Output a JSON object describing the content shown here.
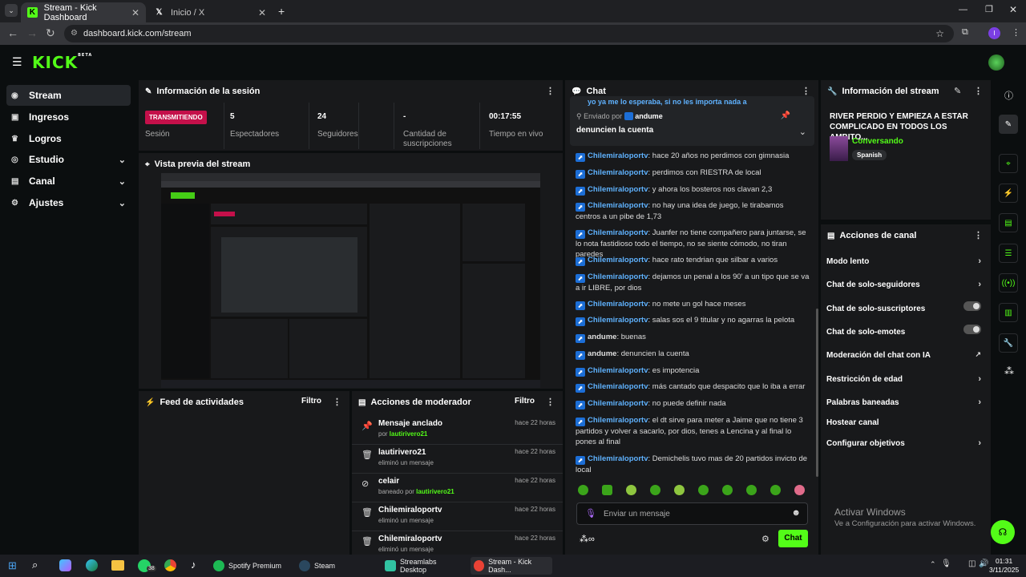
{
  "browser": {
    "tabs": [
      {
        "title": "Stream - Kick Dashboard",
        "active": true
      },
      {
        "title": "Inicio / X",
        "active": false
      }
    ],
    "url": "dashboard.kick.com/stream",
    "profile_initial": "I"
  },
  "header": {
    "logo": "KICK",
    "logo_tag": "BETA"
  },
  "sidebar": {
    "items": [
      {
        "label": "Stream",
        "icon": "stream-icon",
        "active": true
      },
      {
        "label": "Ingresos",
        "icon": "wallet-icon"
      },
      {
        "label": "Logros",
        "icon": "trophy-icon"
      },
      {
        "label": "Estudio",
        "icon": "studio-icon",
        "expandable": true
      },
      {
        "label": "Canal",
        "icon": "channel-icon",
        "expandable": true
      },
      {
        "label": "Ajustes",
        "icon": "gear-icon",
        "expandable": true
      }
    ]
  },
  "session": {
    "title": "Información de la sesión",
    "status_badge": "TRANSMITIENDO",
    "status_label": "Sesión",
    "stats": [
      {
        "value": "5",
        "label": "Espectadores"
      },
      {
        "value": "24",
        "label": "Seguidores"
      },
      {
        "value": "-",
        "label": "Cantidad de suscripciones"
      },
      {
        "value": "00:17:55",
        "label": "Tiempo en vivo"
      }
    ]
  },
  "preview": {
    "title": "Vista previa del stream"
  },
  "activity": {
    "title": "Feed de actividades",
    "filter_label": "Filtro"
  },
  "moderator": {
    "title": "Acciones de moderador",
    "filter_label": "Filtro",
    "items": [
      {
        "icon": "pin-icon",
        "title": "Mensaje anclado",
        "sub_prefix": "por ",
        "sub_user": "lautirivero21",
        "time": "hace 22 horas"
      },
      {
        "icon": "trash-icon",
        "title": "lautirivero21",
        "sub_prefix": "eliminó un mensaje",
        "sub_user": "",
        "time": "hace 22 horas"
      },
      {
        "icon": "ban-icon",
        "title": "celair",
        "sub_prefix": "baneado por ",
        "sub_user": "lautirivero21",
        "time": "hace 22 horas"
      },
      {
        "icon": "trash-icon",
        "title": "Chilemiraloportv",
        "sub_prefix": "eliminó un mensaje",
        "sub_user": "",
        "time": "hace 22 horas"
      },
      {
        "icon": "trash-icon",
        "title": "Chilemiraloportv",
        "sub_prefix": "eliminó un mensaje",
        "sub_user": "",
        "time": "hace 22 horas"
      }
    ]
  },
  "chat": {
    "title": "Chat",
    "pinned": {
      "by_label": "Enviado por",
      "by_user": "andume",
      "text": "denuncien la cuenta",
      "behind_text": "yo ya me lo esperaba, si no les importa nada a"
    },
    "messages": [
      {
        "user": "Chilemiraloportv",
        "badge": true,
        "text": "hace 20 años no perdimos con gimnasia"
      },
      {
        "user": "Chilemiraloportv",
        "badge": true,
        "text": "perdimos con RIESTRA de local"
      },
      {
        "user": "Chilemiraloportv",
        "badge": true,
        "text": "y ahora los bosteros nos clavan 2,3"
      },
      {
        "user": "Chilemiraloportv",
        "badge": true,
        "text": "no hay una idea de juego, le tirabamos centros a un pibe de 1,73"
      },
      {
        "user": "Chilemiraloportv",
        "badge": true,
        "text": "Juanfer no tiene compañero para juntarse, se lo nota fastidioso todo el tiempo, no se siente cómodo, no tiran paredes"
      },
      {
        "user": "Chilemiraloportv",
        "badge": true,
        "text": "hace rato tendrian que silbar a varios"
      },
      {
        "user": "Chilemiraloportv",
        "badge": true,
        "text": "dejamos un penal a los 90' a un tipo que se va a ir LIBRE, por dios"
      },
      {
        "user": "Chilemiraloportv",
        "badge": true,
        "text": "no mete un gol hace meses"
      },
      {
        "user": "Chilemiraloportv",
        "badge": true,
        "text": "salas sos el 9 titular y no agarras la pelota"
      },
      {
        "user": "andume",
        "badge": true,
        "text": "buenas"
      },
      {
        "user": "andume",
        "badge": true,
        "text": "denuncien la cuenta"
      },
      {
        "user": "Chilemiraloportv",
        "badge": true,
        "text": "es impotencia"
      },
      {
        "user": "Chilemiraloportv",
        "badge": true,
        "text": "más cantado que despacito que lo iba a errar"
      },
      {
        "user": "Chilemiraloportv",
        "badge": true,
        "text": "no puede definir nada"
      },
      {
        "user": "Chilemiraloportv",
        "badge": true,
        "text": "el dt sirve para meter a Jaime que no tiene 3 partidos y volver a sacarlo, por dios, tenes a Lencina y al final lo pones al final"
      },
      {
        "user": "Chilemiraloportv",
        "badge": true,
        "text": "Demichelis tuvo mas de 20 partidos invicto de local"
      }
    ],
    "input_placeholder": "Enviar un mensaje",
    "send_label": "Chat"
  },
  "stream_info": {
    "title": "Información del stream",
    "stream_title": "RIVER PERDIO Y EMPIEZA A ESTAR COMPLICADO EN TODOS LOS AMBITO...",
    "category": "Conversando",
    "language": "Spanish"
  },
  "channel_actions": {
    "title": "Acciones de canal",
    "items": [
      {
        "label": "Modo lento",
        "control": "chevron"
      },
      {
        "label": "Chat de solo-seguidores",
        "control": "chevron"
      },
      {
        "label": "Chat de solo-suscriptores",
        "control": "toggle"
      },
      {
        "label": "Chat de solo-emotes",
        "control": "toggle"
      },
      {
        "label": "Moderación del chat con IA",
        "control": "external"
      },
      {
        "label": "Restricción de edad",
        "control": "chevron"
      },
      {
        "label": "Palabras baneadas",
        "control": "chevron"
      },
      {
        "label": "Hostear canal",
        "control": "none"
      },
      {
        "label": "Configurar objetivos",
        "control": "chevron"
      }
    ]
  },
  "watermark": {
    "line1": "Activar Windows",
    "line2": "Ve a Configuración para activar Windows."
  },
  "taskbar": {
    "apps": [
      {
        "label": "Spotify Premium",
        "color": "#1db954"
      },
      {
        "label": "Steam",
        "color": "#1b2838"
      },
      {
        "label": "Streamlabs Desktop",
        "color": "#31c3a2"
      },
      {
        "label": "Stream - Kick Dash...",
        "color": "#e94235"
      }
    ],
    "whatsapp_count": "38",
    "time": "01:31",
    "date": "3/11/2025"
  }
}
